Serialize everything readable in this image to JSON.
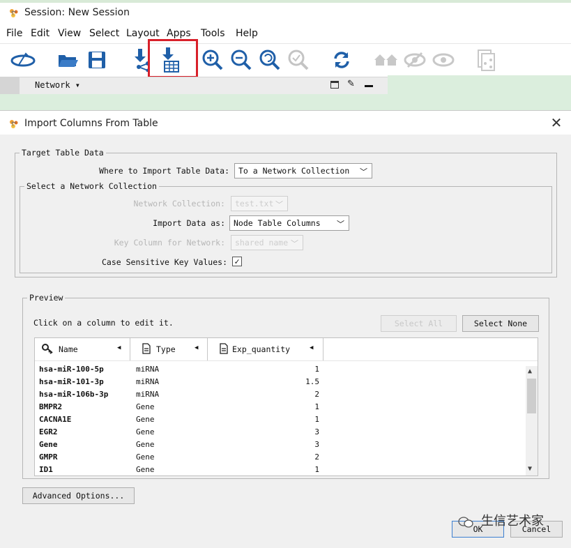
{
  "background_window": {
    "title": "Session: New Session",
    "menu": [
      "File",
      "Edit",
      "View",
      "Select",
      "Layout",
      "Apps",
      "Tools",
      "Help"
    ],
    "toolbar_icons": [
      "new-network-from-selection-icon",
      "open-folder-icon",
      "save-icon",
      "import-network-icon",
      "import-table-icon",
      "zoom-in-icon",
      "zoom-out-icon",
      "zoom-fit-icon",
      "zoom-selected-icon",
      "refresh-icon",
      "home-icon",
      "hide-icon",
      "show-icon",
      "export-icon"
    ],
    "network_tab": "Network"
  },
  "dialog": {
    "title": "Import Columns From Table",
    "target": {
      "legend": "Target Table Data",
      "where_label": "Where to Import Table Data:",
      "where_value": "To a Network Collection"
    },
    "collection": {
      "legend": "Select a Network Collection",
      "collection_label": "Network Collection:",
      "collection_value": "test.txt",
      "import_as_label": "Import Data as:",
      "import_as_value": "Node Table Columns",
      "key_label": "Key Column for Network:",
      "key_value": "shared name",
      "case_label": "Case Sensitive Key Values:",
      "case_checked": "✓"
    },
    "preview": {
      "legend": "Preview",
      "hint": "Click on a column to edit it.",
      "select_all": "Select All",
      "select_none": "Select None",
      "columns": [
        "Name",
        "Type",
        "Exp_quantity"
      ],
      "rows": [
        [
          "hsa-miR-100-5p",
          "miRNA",
          "1"
        ],
        [
          "hsa-miR-101-3p",
          "miRNA",
          "1.5"
        ],
        [
          "hsa-miR-106b-3p",
          "miRNA",
          "2"
        ],
        [
          "BMPR2",
          "Gene",
          "1"
        ],
        [
          "CACNA1E",
          "Gene",
          "1"
        ],
        [
          "EGR2",
          "Gene",
          "3"
        ],
        [
          "Gene",
          "Gene",
          "3"
        ],
        [
          "GMPR",
          "Gene",
          "2"
        ],
        [
          "ID1",
          "Gene",
          "1"
        ]
      ]
    },
    "advanced_button": "Advanced Options...",
    "ok_button": "OK",
    "cancel_button": "Cancel"
  },
  "watermark": "生信艺术家",
  "colors": {
    "highlight": "#d8202a",
    "accent_blue": "#1f5fa8",
    "check_green_band": "#dbeedd"
  }
}
